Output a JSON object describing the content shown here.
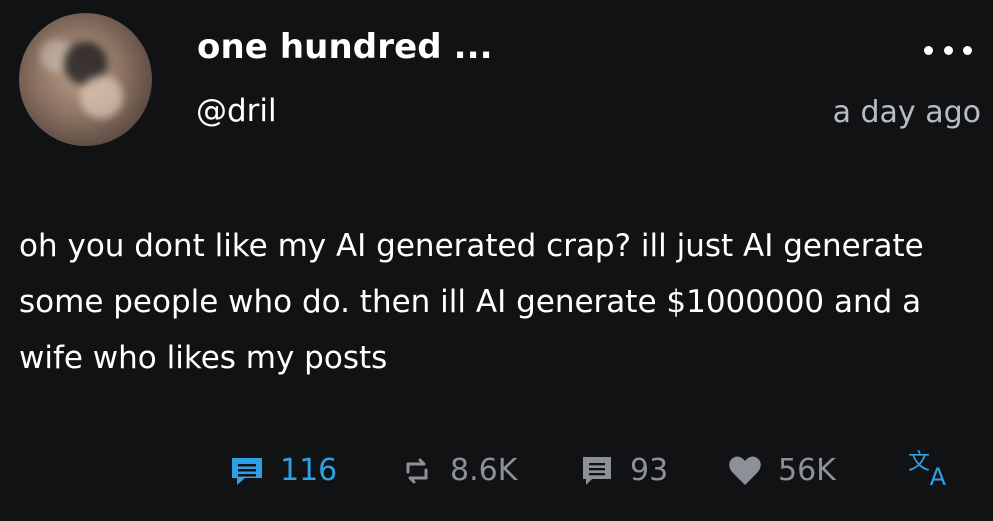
{
  "post": {
    "author": "one hundred ...",
    "handle": "@dril",
    "time": "a day ago",
    "text": "oh you dont like my AI generated crap? ill just AI generate some people who do. then ill AI generate $1000000 and a wife who likes my posts"
  },
  "actions": {
    "comments": "116",
    "reposts": "8.6K",
    "quotes": "93",
    "likes": "56K",
    "translate_glyph_top": "文",
    "translate_glyph_bottom": "A"
  },
  "colors": {
    "background": "#111214",
    "primary_text": "#ffffff",
    "secondary_text": "#b7bcc5",
    "accent": "#2f9fe8",
    "muted_icon": "#8d9096"
  },
  "icons": {
    "menu": "ellipsis-horizontal-icon",
    "comments": "comment-icon",
    "reposts": "repost-icon",
    "quotes": "quote-icon",
    "likes": "heart-icon",
    "translate": "translate-icon"
  }
}
